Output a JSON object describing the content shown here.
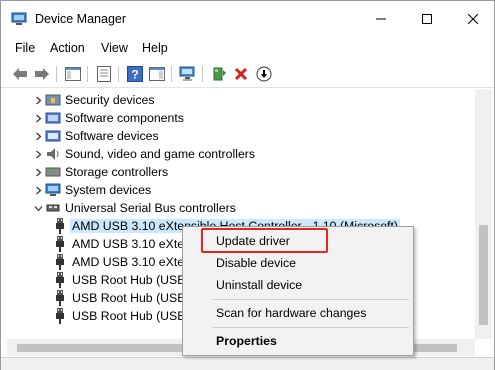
{
  "window": {
    "title": "Device Manager"
  },
  "menu": [
    "File",
    "Action",
    "View",
    "Help"
  ],
  "tree": {
    "rows": [
      {
        "label": "Security devices",
        "expanded": false,
        "icon": "security-device-icon"
      },
      {
        "label": "Software components",
        "expanded": false,
        "icon": "software-component-icon"
      },
      {
        "label": "Software devices",
        "expanded": false,
        "icon": "software-device-icon"
      },
      {
        "label": "Sound, video and game controllers",
        "expanded": false,
        "icon": "speaker-icon"
      },
      {
        "label": "Storage controllers",
        "expanded": false,
        "icon": "storage-controller-icon"
      },
      {
        "label": "System devices",
        "expanded": false,
        "icon": "system-device-icon"
      },
      {
        "label": "Universal Serial Bus controllers",
        "expanded": true,
        "icon": "usb-icon"
      },
      {
        "label": "AMD USB 3.10 eXtensible Host Controller - 1.10 (Microsoft)",
        "child": true,
        "selected": true,
        "icon": "usb-plug-icon"
      },
      {
        "label": "AMD USB 3.10 eXtensible Host Controller - 1.10 (Microsoft)",
        "child": true,
        "icon": "usb-plug-icon"
      },
      {
        "label": "AMD USB 3.10 eXtensible Host Controller - 1.10 (Microsoft)",
        "child": true,
        "icon": "usb-plug-icon"
      },
      {
        "label": "USB Root Hub (USB 3.0)",
        "child": true,
        "icon": "usb-plug-icon"
      },
      {
        "label": "USB Root Hub (USB 3.0)",
        "child": true,
        "icon": "usb-plug-icon"
      },
      {
        "label": "USB Root Hub (USB 3.0)",
        "child": true,
        "icon": "usb-plug-icon"
      }
    ]
  },
  "context_menu": {
    "items": [
      {
        "label": "Update driver"
      },
      {
        "label": "Disable device"
      },
      {
        "label": "Uninstall device"
      },
      {
        "label": "Scan for hardware changes"
      },
      {
        "label": "Properties",
        "bold": true
      }
    ]
  },
  "colors": {
    "selection": "#cce8ff",
    "highlight_outline": "#e0281e",
    "delete_red": "#d42020",
    "green": "#2f8a2f"
  }
}
